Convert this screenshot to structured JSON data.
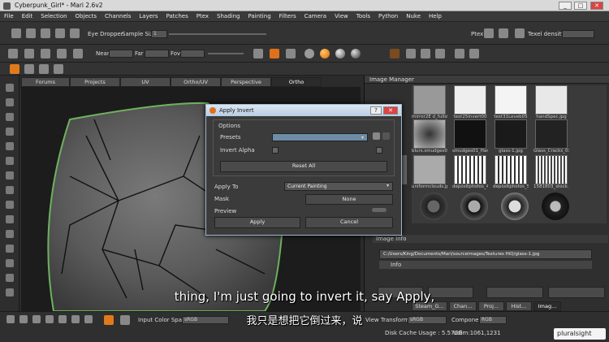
{
  "window": {
    "title": "Cyberpunk_Girl* - Mari 2.6v2",
    "controls": [
      "_",
      "□",
      "✕"
    ]
  },
  "menu": [
    "File",
    "Edit",
    "Selection",
    "Objects",
    "Channels",
    "Layers",
    "Patches",
    "Ptex",
    "Shading",
    "Painting",
    "Filters",
    "Camera",
    "View",
    "Tools",
    "Python",
    "Nuke",
    "Help"
  ],
  "toolbar1": {
    "eyedropper": "Eye Dropper",
    "sample_size_label": "Sample Size",
    "sample_size_value": "1",
    "ptex_label": "Ptex",
    "texel_density_label": "Texel density"
  },
  "toolbar2": {
    "near": "Near",
    "far": "Far",
    "fov": "Fov"
  },
  "view_tabs": [
    "Forums",
    "Projects",
    "UV",
    "Ortho/UV",
    "Perspective",
    "Ortho"
  ],
  "image_manager": {
    "title": "Image Manager",
    "row1_captions": [
      "mirror2E d_fullsfull29083",
      "text25Invert00",
      "text31Leveb05",
      "handSpec.jpg"
    ],
    "row2_captions": [
      "blurs.smudges01.jpg",
      "smudges01_Hard",
      "glass-1.jpg",
      "Glass_Cracks_01"
    ],
    "row3_captions": [
      "erly-begin",
      "uniformclouds.jpg",
      "depositphotos_4",
      "depositphotos_5",
      "1581803_stock.p"
    ],
    "image_info_label": "Image Info",
    "path": "C:/Users/King/Documents/Mari/sourceimages/Textures HiQ/glass-1.jpg",
    "info_label": "Info"
  },
  "dialog": {
    "title": "Apply Invert",
    "help": "?",
    "close": "✕",
    "options_label": "Options",
    "presets_label": "Presets",
    "invert_alpha_label": "Invert Alpha",
    "reset_all": "Reset All",
    "apply_to_label": "Apply To",
    "apply_to_value": "Current Painting",
    "mask_label": "Mask",
    "mask_value": "None",
    "preview_label": "Preview",
    "apply_button": "Apply",
    "cancel_button": "Cancel"
  },
  "palette_tabs": [
    "Steam_G...",
    "Chan...",
    "Proj...",
    "Hist...",
    "Imag..."
  ],
  "bottom": {
    "input_color_space_label": "Input Color Space",
    "input_color_space_value": "sRGB",
    "view_transform_label": "View Transform",
    "view_transform_value": "sRGB",
    "component_label": "Component",
    "component_value": "RGB",
    "disk_cache": "Disk Cache Usage : 5.57GB",
    "udim": "Udim:1061,1231",
    "brand": "pluralsight"
  },
  "subtitles": {
    "en": "thing, I'm just going to invert it, say Apply,",
    "zh": "我只是想把它倒过来，说"
  }
}
